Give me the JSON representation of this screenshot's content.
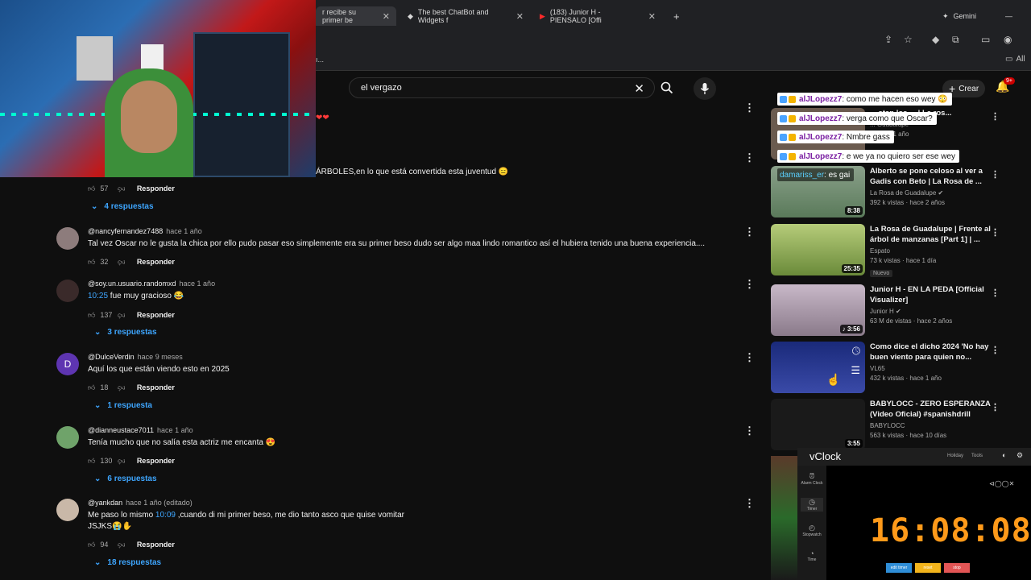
{
  "browser": {
    "tabs": [
      {
        "label": "r recibe su primer be",
        "icon": "page-icon"
      },
      {
        "label": "The best ChatBot and Widgets f",
        "icon": "diamond-icon"
      },
      {
        "label": "(183) Junior H - PIENSALO [Offi",
        "icon": "youtube-icon"
      }
    ],
    "gemini_label": "Gemini",
    "bookmark_folder": "All"
  },
  "youtube": {
    "search_value": "el vergazo",
    "create_label": "Crear",
    "notif_count": "9+"
  },
  "comments": [
    {
      "kind": "partial",
      "text": "ÁRBOLES,en lo que está convertida esta juventud 😑",
      "likes": "57",
      "reply_label": "Responder",
      "replies_label": "4 respuestas"
    },
    {
      "author": "@nancyfernandez7488",
      "time": "hace 1 año",
      "text": "Tal vez Oscar no le gusta la chica por ello pudo pasar eso simplemente era su primer beso dudo ser algo maa lindo romantico así el hubiera tenido una buena experiencia....",
      "likes": "32",
      "reply_label": "Responder",
      "avatar_color": "#8d7c7c"
    },
    {
      "author": "@soy.un.usuario.randomxd",
      "time": "hace 1 año",
      "ts": "10:25",
      "text": " fue muy gracioso 😂",
      "likes": "137",
      "reply_label": "Responder",
      "replies_label": "3 respuestas",
      "avatar_color": "#3a2a2a"
    },
    {
      "author": "@DulceVerdin",
      "time": "hace 9 meses",
      "text": "Aquí los que están viendo esto en 2025",
      "likes": "18",
      "reply_label": "Responder",
      "replies_label": "1 respuesta",
      "avatar_letter": "D",
      "avatar_color": "#5e35b1"
    },
    {
      "author": "@dianneustace7011",
      "time": "hace 1 año",
      "text": "Tenía mucho que no salía esta actriz me encanta 😍",
      "likes": "130",
      "reply_label": "Responder",
      "replies_label": "6 respuestas",
      "avatar_color": "#6fa36a"
    },
    {
      "author": "@yankdan",
      "time": "hace 1 año (editado)",
      "text_before": "Me paso lo mismo ",
      "ts": "10:09",
      "text_after": " ,cuando di mi primer beso, me dio tanto asco que quise vomitar",
      "text_line2": "JSJKS😭✋",
      "likes": "94",
      "reply_label": "Responder",
      "replies_label": "18 respuestas",
      "avatar_color": "#c9b8a8"
    }
  ],
  "sidebar": [
    {
      "title": "... stan los ... | La ros...",
      "channel": "... Guadalupe",
      "stats": "... hace 1 año",
      "thumb": "#6b5b4f"
    },
    {
      "title": "Alberto se pone celoso al ver a Gadis con Beto | La Rosa de ...",
      "channel": "La Rosa de Guadalupe",
      "stats": "392 k vistas · hace 2 años",
      "duration": "8:38",
      "thumb": "#7a8f7a"
    },
    {
      "title": "La Rosa de Guadalupe | Frente al árbol de manzanas [Part 1] | ...",
      "channel": "Espato",
      "stats": "73 k vistas · hace 1 día",
      "badge": "Nuevo",
      "duration": "25:35",
      "thumb": "#9cb86a"
    },
    {
      "title": "Junior H - EN LA PEDA [Official Visualizer]",
      "channel": "Junior H",
      "stats": "63 M de vistas · hace 2 años",
      "duration": "3:56",
      "thumb": "#b8a8b8"
    },
    {
      "title": "Como dice el dicho 2024 'No hay buen viento para quien no...",
      "channel": "VL65",
      "stats": "432 k vistas · hace 1 año",
      "thumb": "#2a3a8a"
    },
    {
      "title": "BABYLOCC - ZERO ESPERANZA (Video Oficial) #spanishdrill",
      "channel": "BABYLOCC",
      "stats": "563 k vistas · hace 10 días",
      "duration": "3:55",
      "thumb": "#1a1a1a"
    }
  ],
  "chat": [
    {
      "user": "alJLopezz7",
      "msg": " : como me hacen eso wey 😳"
    },
    {
      "user": "alJLopezz7",
      "msg": " : verga como que Oscar?"
    },
    {
      "user": "alJLopezz7",
      "msg": " : Nmbre gass"
    },
    {
      "user": "alJLopezz7",
      "msg": " : e we ya no quiero ser ese wey"
    },
    {
      "user": "damariss_er",
      "msg": " : es gai"
    }
  ],
  "vclock": {
    "title": "vClock",
    "menu1": "Holiday",
    "menu2": "Tools",
    "time": "16:08:08",
    "buttons": [
      "edit timer",
      "reset",
      "stop"
    ],
    "button_colors": [
      "#2f8ed8",
      "#f2b41c",
      "#e25555"
    ],
    "side_items": [
      "Alarm Clock",
      "Timer",
      "Stopwatch",
      "Time"
    ],
    "time_color": "#ff9a1a"
  }
}
